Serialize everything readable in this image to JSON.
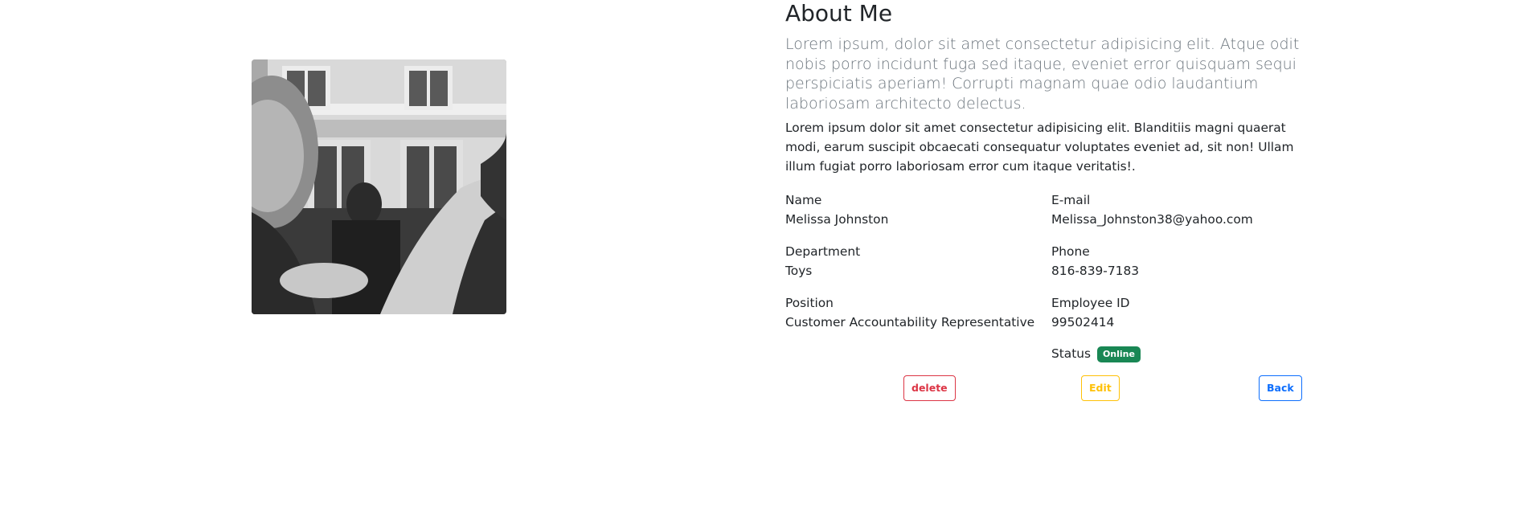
{
  "profile": {
    "photo_alt": "Profile photo"
  },
  "about": {
    "title": "About Me",
    "lead": "Lorem ipsum, dolor sit amet consectetur adipisicing elit. Atque odit nobis porro incidunt fuga sed itaque, eveniet error quisquam sequi perspiciatis aperiam! Corrupti magnam quae odio laudantium laboriosam architecto delectus.",
    "body": "Lorem ipsum dolor sit amet consectetur adipisicing elit. Blanditiis magni quaerat modi, earum suscipit obcaecati consequatur voluptates eveniet ad, sit non! Ullam illum fugiat porro laboriosam error cum itaque veritatis!."
  },
  "fields": {
    "name": {
      "label": "Name",
      "value": "Melissa Johnston"
    },
    "email": {
      "label": "E-mail",
      "value": "Melissa_Johnston38@yahoo.com"
    },
    "department": {
      "label": "Department",
      "value": "Toys"
    },
    "phone": {
      "label": "Phone",
      "value": "816-839-7183"
    },
    "position": {
      "label": "Position",
      "value": "Customer Accountability Representative"
    },
    "employee_id": {
      "label": "Employee ID",
      "value": "99502414"
    },
    "status": {
      "label": "Status",
      "value": "Online"
    }
  },
  "actions": {
    "delete_label": "delete",
    "edit_label": "Edit",
    "back_label": "Back"
  },
  "colors": {
    "danger": "#dc3545",
    "warning": "#ffc107",
    "primary": "#0d6efd",
    "success": "#198754",
    "muted_text": "#6c757d"
  }
}
